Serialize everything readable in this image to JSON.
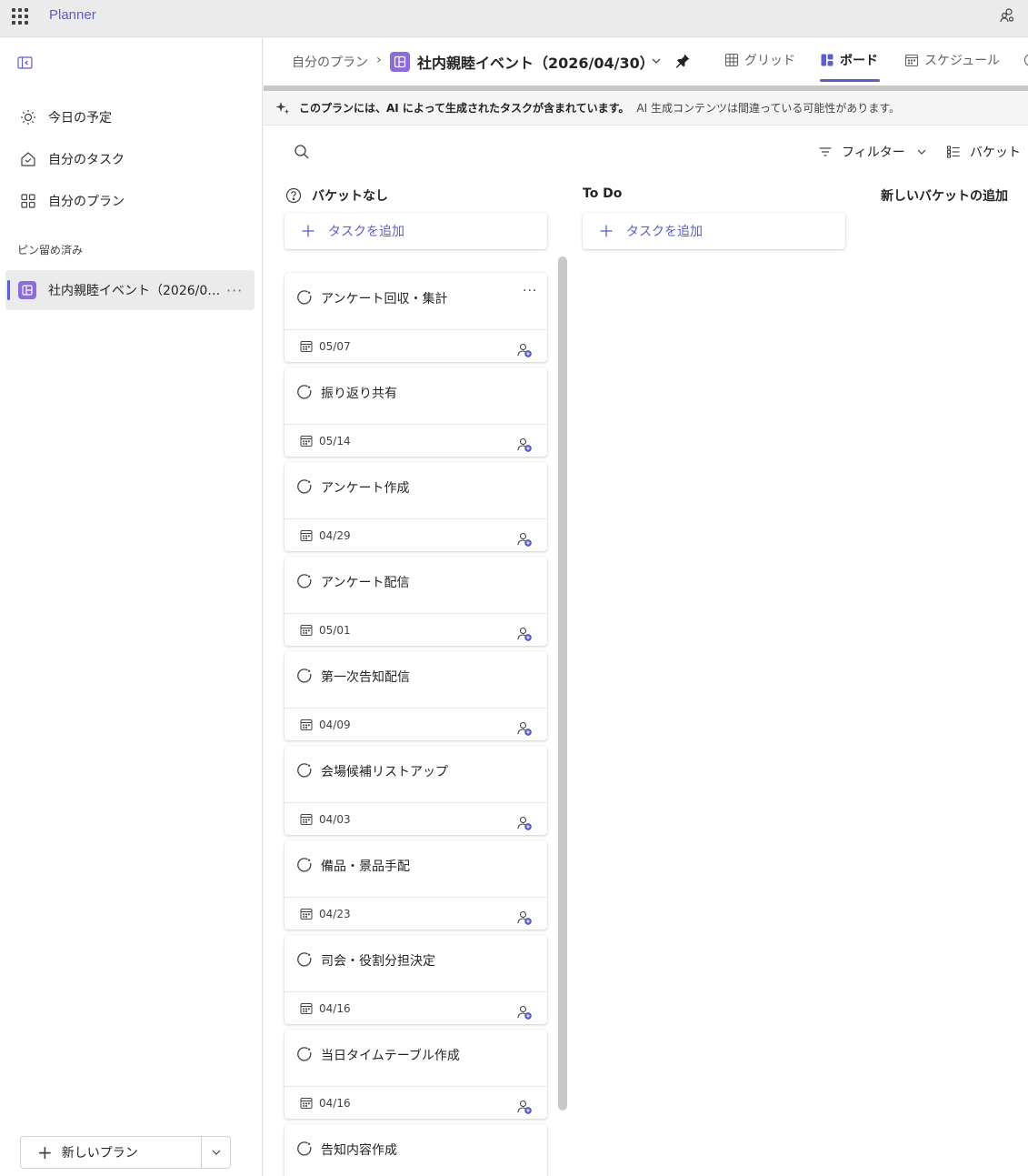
{
  "app": {
    "name": "Planner"
  },
  "sidebar": {
    "nav": [
      {
        "label": "今日の予定",
        "icon": "sun-icon"
      },
      {
        "label": "自分のタスク",
        "icon": "home-icon"
      },
      {
        "label": "自分のプラン",
        "icon": "grid-icon"
      }
    ],
    "pinned_header": "ピン留め済み",
    "pinned": {
      "label": "社内親睦イベント（2026/04/30）",
      "more": "···"
    },
    "new_plan_label": "新しいプラン"
  },
  "header": {
    "breadcrumb": "自分のプラン",
    "separator": "›",
    "plan_title": "社内親睦イベント（2026/04/30）",
    "tabs": [
      {
        "label": "グリッド",
        "icon": "grid-icon",
        "active": false
      },
      {
        "label": "ボード",
        "icon": "board-icon",
        "active": true
      },
      {
        "label": "スケジュール",
        "icon": "calendar-icon",
        "active": false
      }
    ]
  },
  "banner": {
    "bold": "このプランには、AI によって生成されたタスクが含まれています。",
    "normal": "AI 生成コンテンツは間違っている可能性があります。"
  },
  "toolbar": {
    "filter_label": "フィルター",
    "bucket_label": "バケット"
  },
  "board": {
    "columns": [
      {
        "name": "バケットなし",
        "add_label": "タスクを追加"
      },
      {
        "name": "To Do",
        "add_label": "タスクを追加"
      },
      {
        "name": "新しいバケットの追加"
      }
    ],
    "tasks": [
      {
        "title": "アンケート回収・集計",
        "date": "05/07"
      },
      {
        "title": "振り返り共有",
        "date": "05/14"
      },
      {
        "title": "アンケート作成",
        "date": "04/29"
      },
      {
        "title": "アンケート配信",
        "date": "05/01"
      },
      {
        "title": "第一次告知配信",
        "date": "04/09"
      },
      {
        "title": "会場候補リストアップ",
        "date": "04/03"
      },
      {
        "title": "備品・景品手配",
        "date": "04/23"
      },
      {
        "title": "司会・役割分担決定",
        "date": "04/16"
      },
      {
        "title": "当日タイムテーブル作成",
        "date": "04/16"
      },
      {
        "title": "告知内容作成",
        "date": ""
      }
    ],
    "card_more": "···"
  },
  "colors": {
    "accent": "#5b5fc7",
    "plan_icon": "#8b6cd9"
  }
}
